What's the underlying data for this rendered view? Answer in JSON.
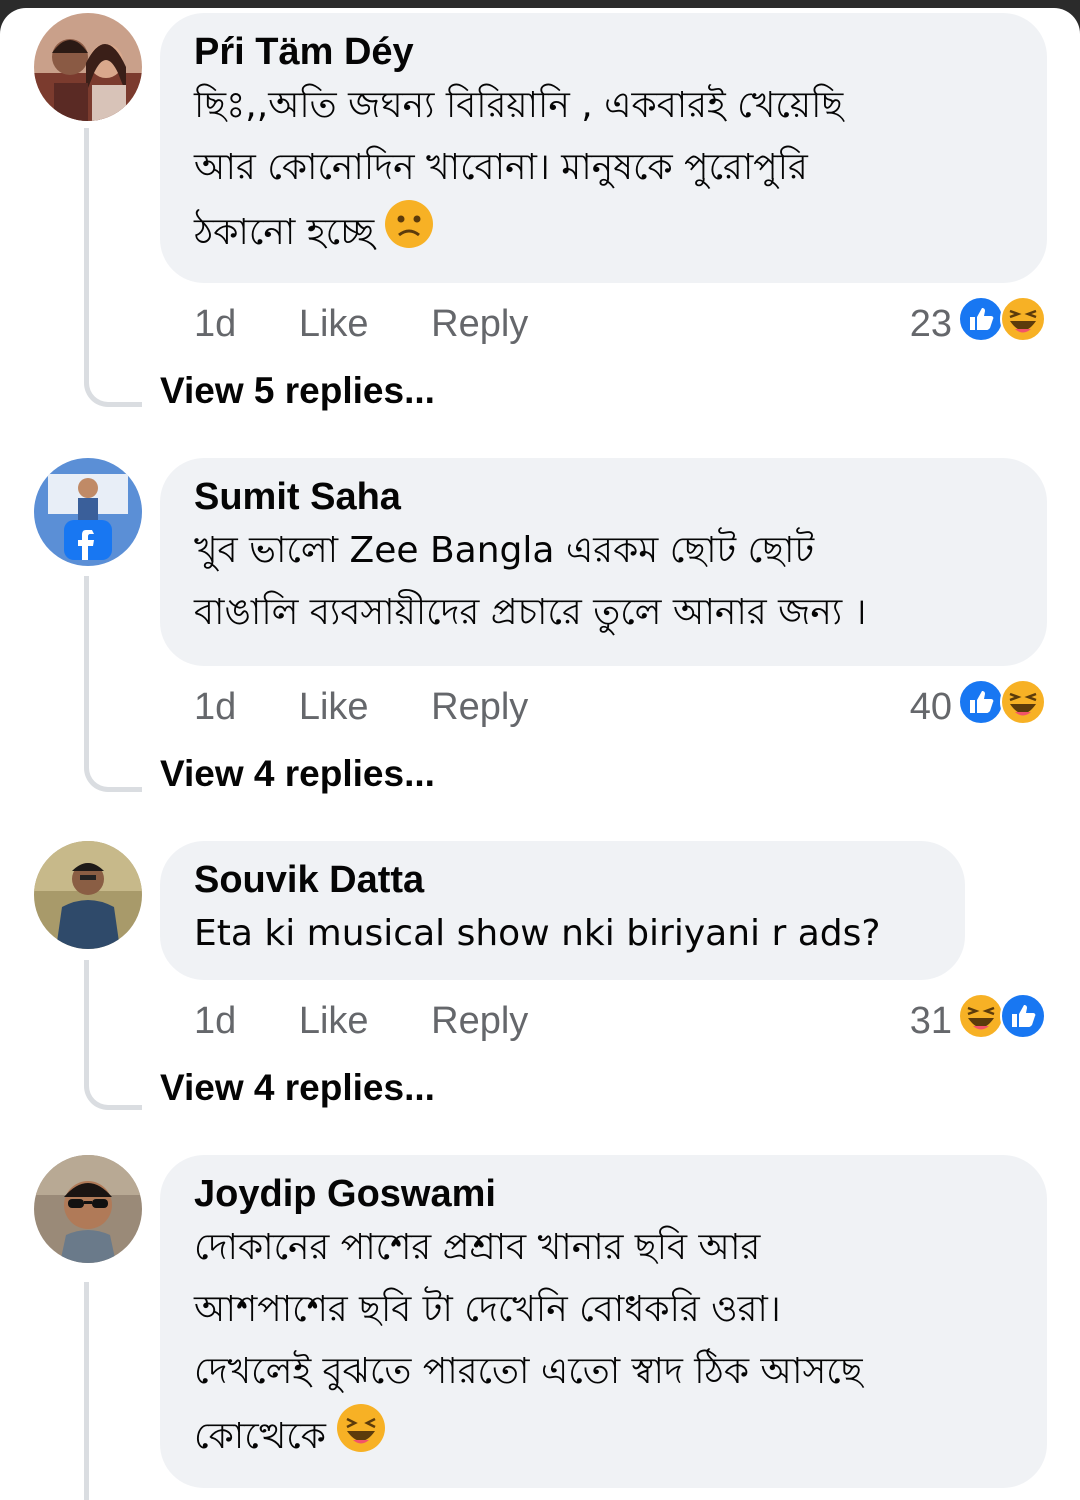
{
  "comments": [
    {
      "author": "Pŕi Täm Déy",
      "lines": [
        "ছিঃ,,অতি জঘন্য বিরিয়ানি , একবারই খেয়েছি",
        "আর কোনোদিন খাবোনা। মানুষকে পুরোপুরি",
        "ঠকানো হচ্ছে"
      ],
      "trailing_emoji": "frowning-face",
      "time": "1d",
      "like": "Like",
      "reply": "Reply",
      "reaction_count": "23",
      "reaction_icons": [
        "like-icon",
        "haha-icon"
      ],
      "view_replies": "View 5 replies..."
    },
    {
      "author": "Sumit Saha",
      "lines": [
        "খুব ভালো Zee Bangla  এরকম ছোট ছোট",
        "বাঙালি ব্যবসায়ীদের প্রচারে তুলে আনার জন্য ।"
      ],
      "time": "1d",
      "like": "Like",
      "reply": "Reply",
      "reaction_count": "40",
      "reaction_icons": [
        "like-icon",
        "haha-icon"
      ],
      "view_replies": "View 4 replies..."
    },
    {
      "author": "Souvik Datta",
      "lines": [
        "Eta ki musical show nki biriyani r ads?"
      ],
      "time": "1d",
      "like": "Like",
      "reply": "Reply",
      "reaction_count": "31",
      "reaction_icons": [
        "haha-icon",
        "like-icon"
      ],
      "view_replies": "View 4 replies..."
    },
    {
      "author": "Joydip Goswami",
      "lines": [
        "দোকানের পাশের প্রশ্রাব খানার ছবি আর",
        "আশপাশের ছবি টা দেখেনি বোধকরি ওরা।",
        "দেখলেই বুঝতে পারতো এতো স্বাদ ঠিক  আসছে",
        "কোত্থেকে"
      ],
      "trailing_emoji": "laughing-face"
    }
  ],
  "colors": {
    "bubble": "#f0f2f5",
    "like_blue": "#1877f2",
    "secondary_text": "#65676b",
    "emoji_yellow": "#f7b125"
  }
}
